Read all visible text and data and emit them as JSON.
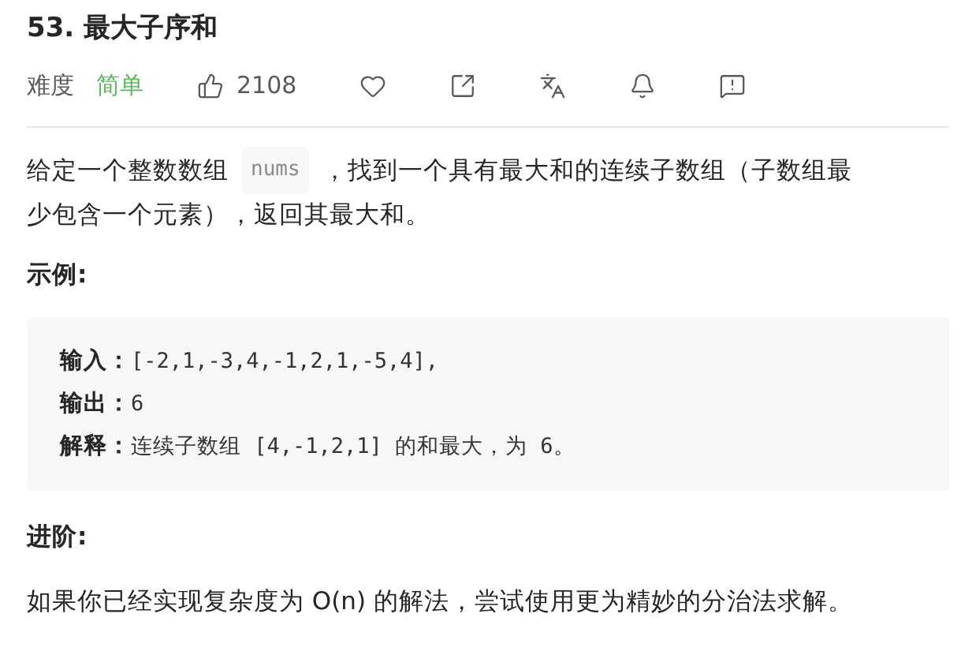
{
  "title": "53. 最大子序和",
  "meta": {
    "difficulty_label": "难度",
    "difficulty": {
      "text": "简单",
      "kind": "easy"
    },
    "likes": "2108"
  },
  "description": {
    "before": "给定一个整数数组",
    "code": "nums",
    "after": "，找到一个具有最大和的连续子数组（子数组最",
    "continuation": "少包含一个元素），返回其最大和。"
  },
  "example_heading": "示例:",
  "example_lines": [
    {
      "label": "输入：",
      "value": "[-2,1,-3,4,-1,2,1,-5,4],"
    },
    {
      "label": "输出：",
      "value": "6"
    },
    {
      "label": "解释：",
      "value": "连续子数组 [4,-1,2,1] 的和最大，为 6。"
    }
  ],
  "advanced_heading": "进阶:",
  "advanced_text": "如果你已经实现复杂度为 O(n) 的解法，尝试使用更为精妙的分治法求解。"
}
